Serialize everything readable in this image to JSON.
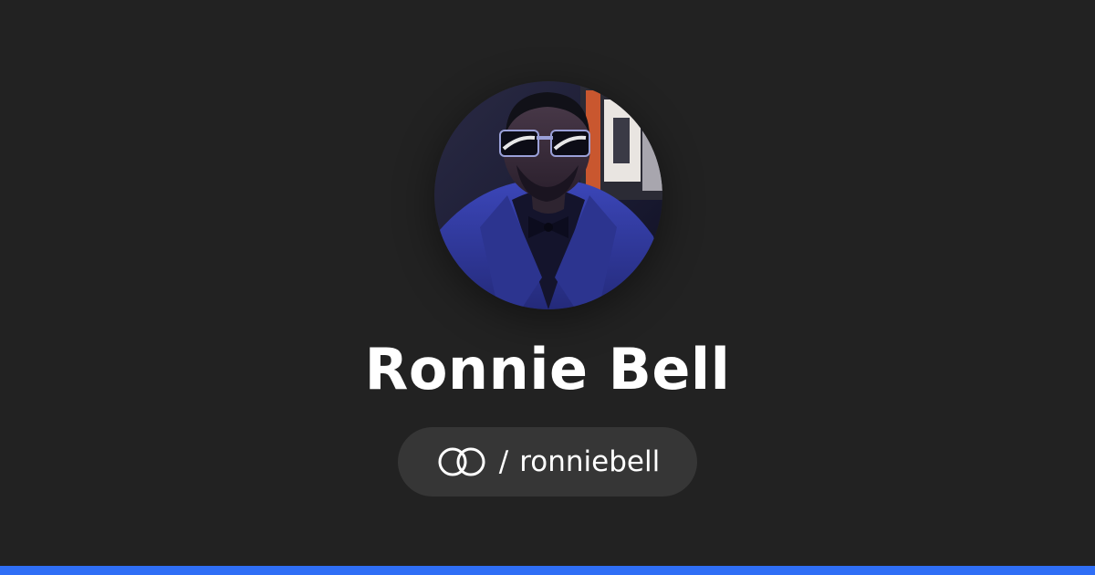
{
  "profile": {
    "name": "Ronnie Bell",
    "handle_separator": "/",
    "handle": "ronniebell",
    "avatar_icon": "profile-photo"
  },
  "icons": {
    "link": "link-rings-icon"
  },
  "colors": {
    "background": "#222222",
    "pill_background": "#363636",
    "text": "#ffffff",
    "accent_bar": "#2f6ff6"
  }
}
